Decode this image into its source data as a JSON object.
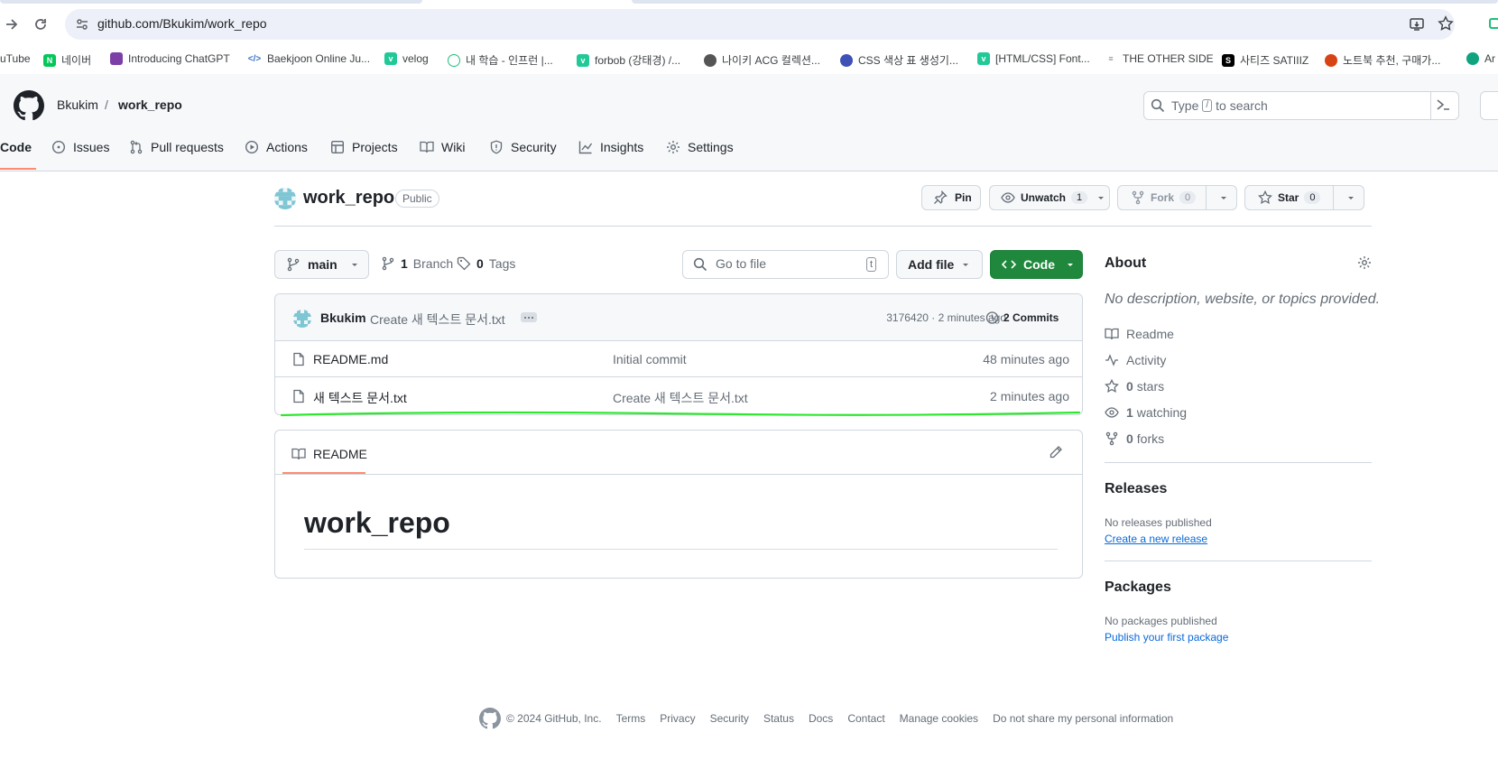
{
  "browser": {
    "url": "github.com/Bkukim/work_repo",
    "bookmarks": [
      {
        "label": "uTube",
        "color": "#ff0000"
      },
      {
        "label": "네이버",
        "color": "#03c75a",
        "glyph": "N"
      },
      {
        "label": "Introducing ChatGPT",
        "color": "#7b3fa6"
      },
      {
        "label": "Baekjoon Online Ju...",
        "color": "#3b73c6",
        "glyph": "</>"
      },
      {
        "label": "velog",
        "color": "#20c997",
        "glyph": "v"
      },
      {
        "label": "내 학습 - 인프런 |...",
        "color": "#1dc078"
      },
      {
        "label": "forbob (강태경) /...",
        "color": "#20c997",
        "glyph": "v"
      },
      {
        "label": "나이키 ACG 컬렉션...",
        "color": "#444444"
      },
      {
        "label": "CSS 색상 표 생성기...",
        "color": "#3f51b5"
      },
      {
        "label": "[HTML/CSS] Font...",
        "color": "#20c997",
        "glyph": "v"
      },
      {
        "label": "THE OTHER SIDE",
        "color": "#888888"
      },
      {
        "label": "사티즈 SATIIIZ",
        "color": "#000000",
        "glyph": "S"
      },
      {
        "label": "노트북 추천, 구매가...",
        "color": "#d84315"
      },
      {
        "label": "Ar",
        "color": "#10a37f"
      }
    ]
  },
  "header": {
    "owner": "Bkukim",
    "separator": "/",
    "repo": "work_repo",
    "search_placeholder_pre": "Type",
    "search_key": "/",
    "search_placeholder_post": "to search"
  },
  "tabs": [
    {
      "label": "Code",
      "icon": "code-icon"
    },
    {
      "label": "Issues",
      "icon": "issue-icon"
    },
    {
      "label": "Pull requests",
      "icon": "pull-request-icon"
    },
    {
      "label": "Actions",
      "icon": "play-icon"
    },
    {
      "label": "Projects",
      "icon": "table-icon"
    },
    {
      "label": "Wiki",
      "icon": "book-icon"
    },
    {
      "label": "Security",
      "icon": "shield-icon"
    },
    {
      "label": "Insights",
      "icon": "graph-icon"
    },
    {
      "label": "Settings",
      "icon": "gear-icon"
    }
  ],
  "repo": {
    "name": "work_repo",
    "visibility": "Public",
    "pin_label": "Pin",
    "unwatch_label": "Unwatch",
    "watch_count": "1",
    "fork_label": "Fork",
    "fork_count": "0",
    "star_label": "Star",
    "star_count": "0"
  },
  "branch_bar": {
    "branch": "main",
    "branch_count": "1",
    "branch_label": "Branch",
    "tag_count": "0",
    "tag_label": "Tags",
    "go_to_file": "Go to file",
    "go_to_file_key": "t",
    "add_file": "Add file",
    "code": "Code"
  },
  "latest_commit": {
    "author": "Bkukim",
    "message": "Create 새 텍스트 문서.txt",
    "meta": "3176420 · 2 minutes ago",
    "commits": "2 Commits"
  },
  "files": [
    {
      "name": "README.md",
      "message": "Initial commit",
      "time": "48 minutes ago"
    },
    {
      "name": "새 텍스트 문서.txt",
      "message": "Create 새 텍스트 문서.txt",
      "time": "2 minutes ago"
    }
  ],
  "readme": {
    "tab": "README",
    "heading": "work_repo"
  },
  "about": {
    "title": "About",
    "description": "No description, website, or topics provided.",
    "readme": "Readme",
    "activity": "Activity",
    "stars_count": "0",
    "stars_label": "stars",
    "watching_count": "1",
    "watching_label": "watching",
    "forks_count": "0",
    "forks_label": "forks"
  },
  "releases": {
    "title": "Releases",
    "none": "No releases published",
    "create": "Create a new release"
  },
  "packages": {
    "title": "Packages",
    "none": "No packages published",
    "publish": "Publish your first package"
  },
  "footer": {
    "copyright": "© 2024 GitHub, Inc.",
    "links": [
      "Terms",
      "Privacy",
      "Security",
      "Status",
      "Docs",
      "Contact",
      "Manage cookies",
      "Do not share my personal information"
    ]
  },
  "colors": {
    "annotation_green": "#2ee82e",
    "primary_green": "#1f883d",
    "link_blue": "#0969da",
    "tab_underline": "#fd8c73"
  }
}
